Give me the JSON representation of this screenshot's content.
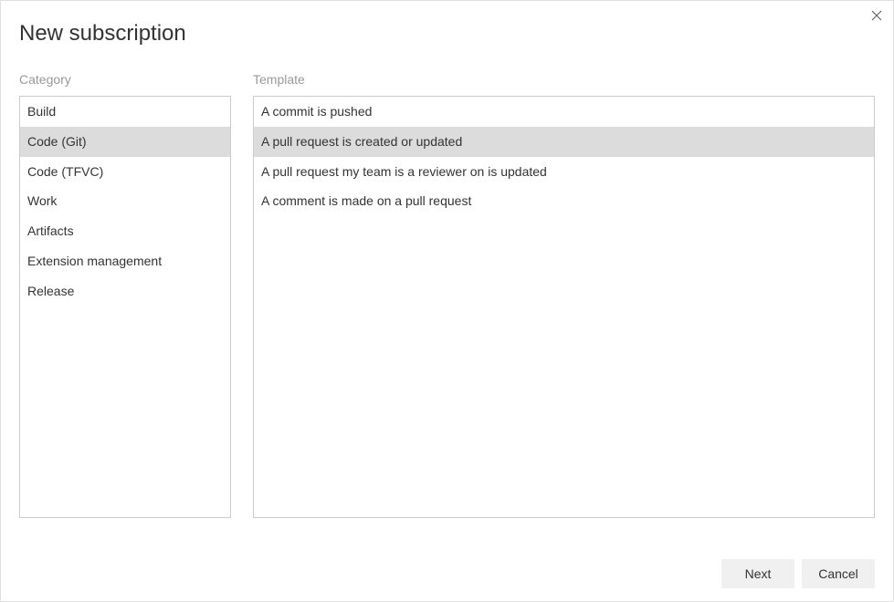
{
  "dialog": {
    "title": "New subscription"
  },
  "categoryPanel": {
    "label": "Category",
    "selectedIndex": 1,
    "items": [
      "Build",
      "Code (Git)",
      "Code (TFVC)",
      "Work",
      "Artifacts",
      "Extension management",
      "Release"
    ]
  },
  "templatePanel": {
    "label": "Template",
    "selectedIndex": 1,
    "items": [
      "A commit is pushed",
      "A pull request is created or updated",
      "A pull request my team is a reviewer on is updated",
      "A comment is made on a pull request"
    ]
  },
  "footer": {
    "nextLabel": "Next",
    "cancelLabel": "Cancel"
  }
}
